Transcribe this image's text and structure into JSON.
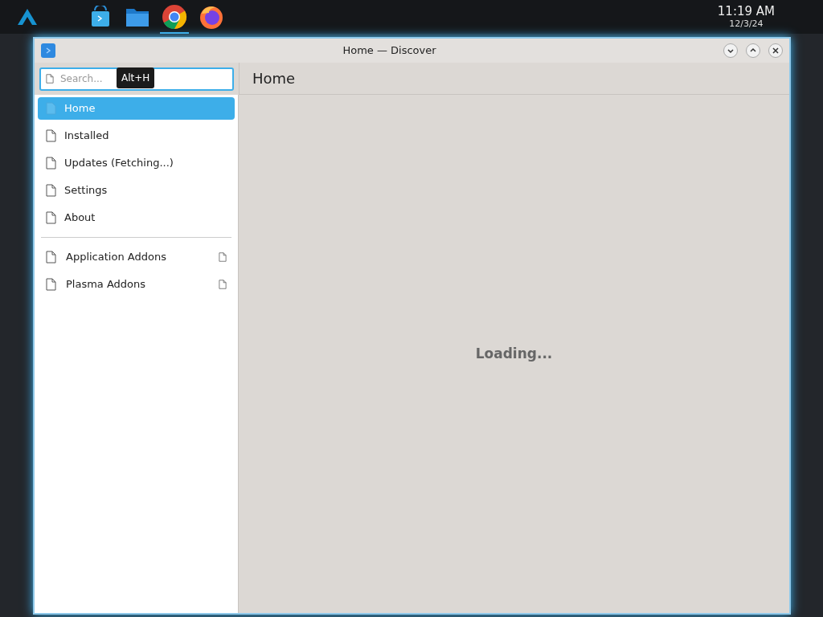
{
  "panel": {
    "launchers": [
      {
        "kind": "store"
      },
      {
        "kind": "files"
      },
      {
        "kind": "chrome",
        "active": true
      },
      {
        "kind": "firefox"
      }
    ],
    "clock": {
      "time": "11:19 AM",
      "date": "12/3/24"
    }
  },
  "window": {
    "title": "Home — Discover"
  },
  "search": {
    "placeholder": "Search...",
    "tooltip": "Alt+H"
  },
  "sidebar": {
    "items": [
      {
        "label": "Home",
        "selected": true
      },
      {
        "label": "Installed",
        "selected": false
      },
      {
        "label": "Updates (Fetching...)",
        "selected": false
      },
      {
        "label": "Settings",
        "selected": false
      },
      {
        "label": "About",
        "selected": false
      }
    ],
    "addons": [
      {
        "label": "Application Addons",
        "selected": false
      },
      {
        "label": "Plasma Addons",
        "selected": false
      }
    ]
  },
  "page": {
    "title": "Home",
    "status": "Loading..."
  }
}
